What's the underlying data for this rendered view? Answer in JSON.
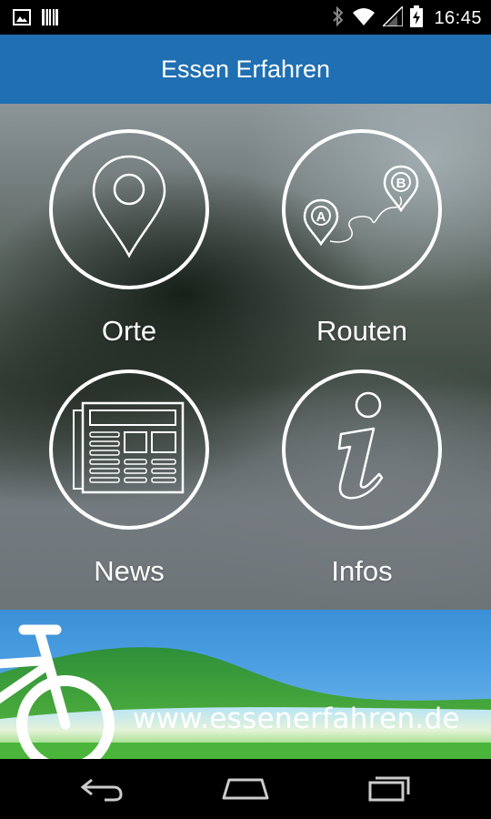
{
  "status_bar": {
    "time": "16:45",
    "icons": [
      "image-notification-icon",
      "barcode-notification-icon",
      "bluetooth-icon",
      "wifi-icon",
      "signal-icon",
      "battery-charging-icon"
    ]
  },
  "app_bar": {
    "title": "Essen Erfahren",
    "color": "#1f6fb2"
  },
  "menu": {
    "tiles": [
      {
        "label": "Orte",
        "icon": "map-pin-icon"
      },
      {
        "label": "Routen",
        "icon": "route-icon"
      },
      {
        "label": "News",
        "icon": "newspaper-icon"
      },
      {
        "label": "Infos",
        "icon": "info-icon"
      }
    ]
  },
  "banner": {
    "url_text": "www.essenerfahren.de",
    "icon": "bicycle-icon"
  },
  "nav_bar": {
    "buttons": [
      "back-icon",
      "home-icon",
      "recents-icon"
    ]
  }
}
